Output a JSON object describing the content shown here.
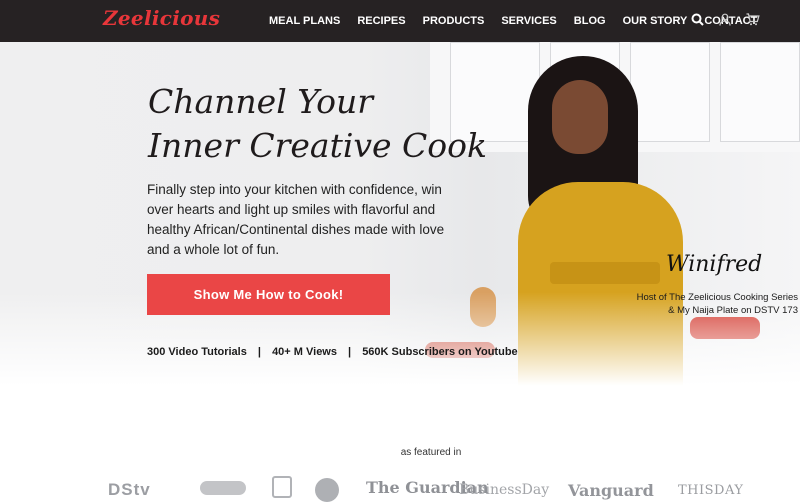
{
  "brand": {
    "logo_text": "Zeelicious"
  },
  "nav": {
    "items": [
      "MEAL PLANS",
      "RECIPES",
      "PRODUCTS",
      "SERVICES",
      "BLOG",
      "OUR STORY",
      "CONTACT"
    ],
    "icons": [
      "search-icon",
      "user-icon",
      "cart-icon"
    ]
  },
  "hero": {
    "headline_line1": "Channel Your",
    "headline_line2": "Inner Creative Cook",
    "subcopy": "Finally step into your kitchen with confidence, win over hearts and light up smiles with flavorful and healthy African/Continental dishes made with love and a whole lot of fun.",
    "cta_label": "Show Me How to Cook!",
    "stats": [
      "300 Video Tutorials",
      "40+ M Views",
      "560K Subscribers on Youtube"
    ],
    "stats_separator": "|",
    "signature": "Winifred",
    "host_line1": "Host of The Zeelicious Cooking Series",
    "host_line2": "& My Naija Plate on DSTV 173"
  },
  "featured": {
    "label": "as featured in",
    "brands": [
      "DStv",
      "",
      "",
      "",
      "The Guardian",
      "BusinessDay",
      "Vanguard",
      "THISDAY"
    ]
  },
  "colors": {
    "nav_bg": "#262223",
    "accent": "#ea4646",
    "logo": "#e8363a",
    "dress": "#d6a21f"
  }
}
